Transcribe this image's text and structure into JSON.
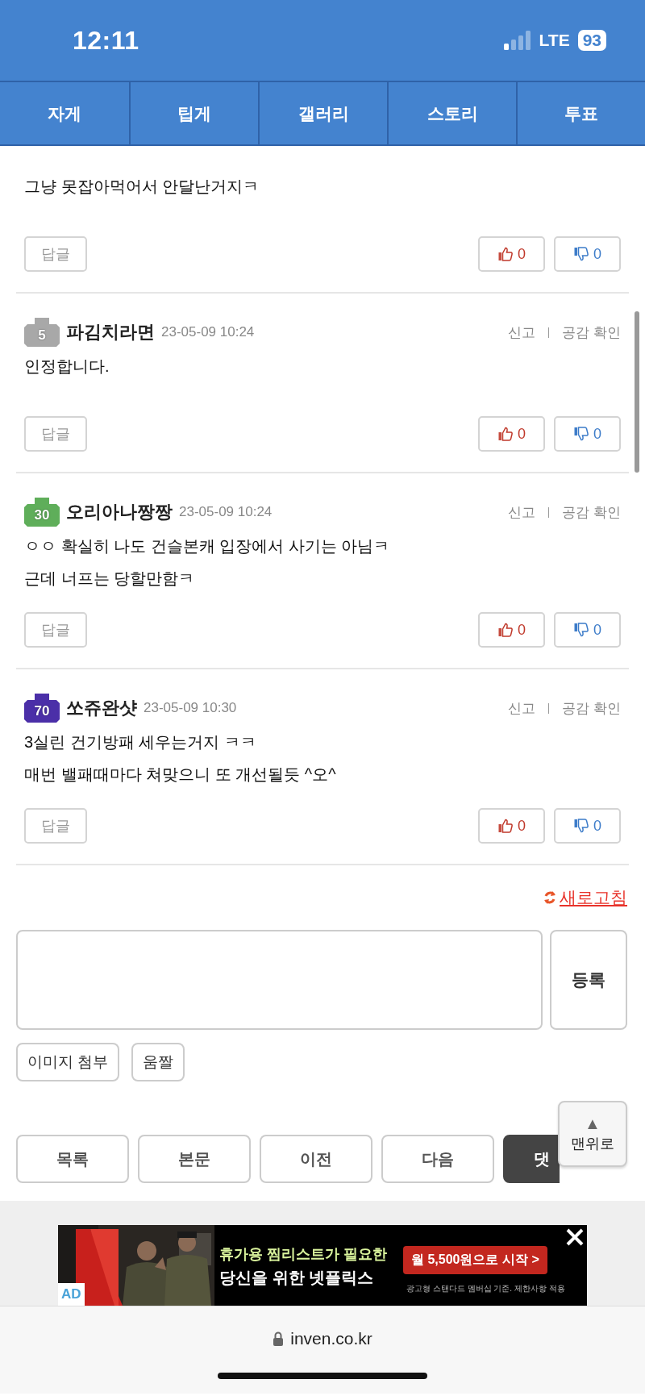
{
  "status_bar": {
    "time": "12:11",
    "network": "LTE",
    "battery": "93"
  },
  "nav_tabs": [
    {
      "label": "자게"
    },
    {
      "label": "팁게"
    },
    {
      "label": "갤러리"
    },
    {
      "label": "스토리"
    },
    {
      "label": "투표"
    }
  ],
  "comments": [
    {
      "body": "그냥 못잡아먹어서 안달난거지ㅋ",
      "reply": "답글",
      "likes": "0",
      "dislikes": "0"
    },
    {
      "badge": {
        "level": "5",
        "color": "#a8a8a8"
      },
      "author": "파김치라면",
      "date": "23-05-09 10:24",
      "report": "신고",
      "empathy": "공감 확인",
      "body": "인정합니다.",
      "reply": "답글",
      "likes": "0",
      "dislikes": "0"
    },
    {
      "badge": {
        "level": "30",
        "color": "#5fae5a"
      },
      "author": "오리아나짱짱",
      "date": "23-05-09 10:24",
      "report": "신고",
      "empathy": "공감 확인",
      "body": "ㅇㅇ 확실히 나도 건슬본캐 입장에서 사기는 아님ㅋ\n근데 너프는 당할만함ㅋ",
      "reply": "답글",
      "likes": "0",
      "dislikes": "0"
    },
    {
      "badge": {
        "level": "70",
        "color": "#4b2fa8"
      },
      "author": "쏘쥬완샷",
      "date": "23-05-09 10:30",
      "report": "신고",
      "empathy": "공감 확인",
      "body": "3실린 건기방패 세우는거지 ㅋㅋ\n매번 밸패때마다 쳐맞으니 또 개선될듯 ^오^",
      "reply": "답글",
      "likes": "0",
      "dislikes": "0"
    }
  ],
  "refresh": "새로고침",
  "compose": {
    "submit": "등록",
    "attachments": [
      "이미지 첨부",
      "움짤"
    ]
  },
  "bottom_nav": [
    {
      "label": "목록",
      "kind": "plain"
    },
    {
      "label": "본문",
      "kind": "plain"
    },
    {
      "label": "이전",
      "kind": "plain"
    },
    {
      "label": "다음",
      "kind": "plain"
    },
    {
      "label": "댓",
      "kind": "dark"
    }
  ],
  "scroll_top": {
    "arrow": "▲",
    "label": "맨위로"
  },
  "ad": {
    "headline": "휴가용 찜리스트가 필요한",
    "subhead": "당신을 위한 넷플릭스",
    "cta": "월 5,500원으로 시작 >",
    "disclaimer": "광고형 스탠다드 멤버십 기준. 제한사항 적용",
    "badge": "AD"
  },
  "address_bar": {
    "url": "inven.co.kr"
  }
}
